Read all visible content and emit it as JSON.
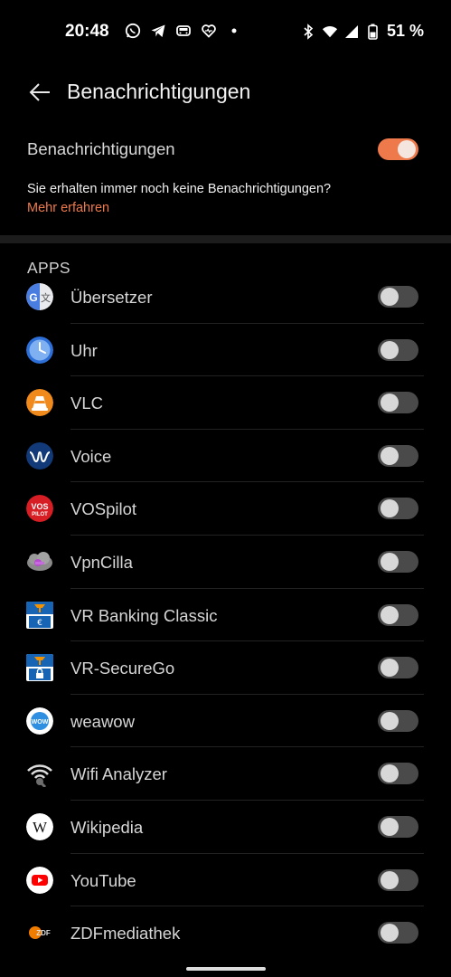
{
  "status_bar": {
    "time": "20:48",
    "left_icons": [
      "whatsapp-icon",
      "telegram-icon",
      "car-icon",
      "heart-icon",
      "dot-icon"
    ],
    "battery_percent": "51 %"
  },
  "header": {
    "title": "Benachrichtigungen"
  },
  "master": {
    "label": "Benachrichtigungen",
    "enabled": true,
    "note": "Sie erhalten immer noch keine Benachrichtigungen?",
    "link": "Mehr erfahren"
  },
  "section": {
    "title": "APPS"
  },
  "apps": [
    {
      "name": "Übersetzer",
      "icon": "translate-icon",
      "enabled": false
    },
    {
      "name": "Uhr",
      "icon": "clock-icon",
      "enabled": false
    },
    {
      "name": "VLC",
      "icon": "vlc-cone-icon",
      "enabled": false
    },
    {
      "name": "Voice",
      "icon": "voice-wave-icon",
      "enabled": false
    },
    {
      "name": "VOSpilot",
      "icon": "vospilot-icon",
      "icon_text_top": "VOS",
      "icon_text_bottom": "PILOT",
      "enabled": false
    },
    {
      "name": "VpnCilla",
      "icon": "vpncilla-icon",
      "enabled": false
    },
    {
      "name": "VR Banking Classic",
      "icon": "vr-banking-icon",
      "enabled": false
    },
    {
      "name": "VR-SecureGo",
      "icon": "vr-securego-icon",
      "enabled": false
    },
    {
      "name": "weawow",
      "icon": "weawow-icon",
      "icon_text": "WOW",
      "enabled": false
    },
    {
      "name": "Wifi Analyzer",
      "icon": "wifi-analyzer-icon",
      "enabled": false
    },
    {
      "name": "Wikipedia",
      "icon": "wikipedia-icon",
      "icon_text": "W",
      "enabled": false
    },
    {
      "name": "YouTube",
      "icon": "youtube-icon",
      "enabled": false
    },
    {
      "name": "ZDFmediathek",
      "icon": "zdf-icon",
      "icon_text": "ZDF",
      "enabled": false
    }
  ],
  "colors": {
    "accent": "#ee7a4c",
    "background": "#000000",
    "toggle_off": "#4a4a4a"
  }
}
